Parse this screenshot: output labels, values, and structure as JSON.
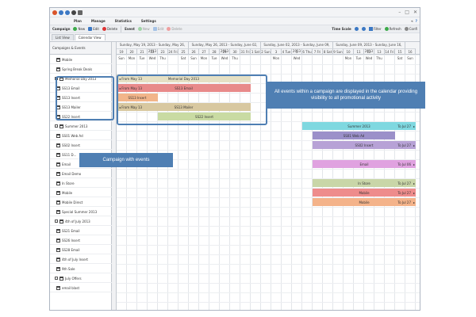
{
  "titlebar": {
    "winbtns": [
      "–",
      "□",
      "✕"
    ]
  },
  "menu": {
    "items": [
      "Plan",
      "Manage",
      "Statistics",
      "Settings"
    ],
    "right": [
      "«",
      "?"
    ]
  },
  "toolbar": {
    "campaign": "Campaign",
    "new": "New",
    "edit": "Edit",
    "delete": "Delete",
    "event": "Event",
    "new2": "New",
    "edit2": "Edit",
    "delete2": "Delete",
    "timescale": "Time Scale",
    "filter": "Filter",
    "refresh": "Refresh",
    "config": "Confi"
  },
  "views": [
    "List View",
    "Calendar View"
  ],
  "left": {
    "header": "Campaigns & Events",
    "rows": [
      {
        "label": "Mobile",
        "group": false
      },
      {
        "label": "Spring Break Deals",
        "group": false
      },
      {
        "label": "Memorial Day 2013",
        "group": true
      },
      {
        "label": "SS13 Email",
        "group": false
      },
      {
        "label": "SS13 Insert",
        "group": false
      },
      {
        "label": "SS13 Mailer",
        "group": false
      },
      {
        "label": "SS22 Insert",
        "group": false
      },
      {
        "label": "Summer 2013",
        "group": true
      },
      {
        "label": "SS01 Web Ad",
        "group": false
      },
      {
        "label": "SS02 Insert",
        "group": false
      },
      {
        "label": "SS11 D...",
        "group": false
      },
      {
        "label": "Email",
        "group": false
      },
      {
        "label": "Email Demo",
        "group": false
      },
      {
        "label": "In Store",
        "group": false
      },
      {
        "label": "Mobile",
        "group": false
      },
      {
        "label": "Mobile Direct",
        "group": false
      },
      {
        "label": "Special Summer 2013",
        "group": false
      },
      {
        "label": "4th of July 2013",
        "group": true
      },
      {
        "label": "SS21 Email",
        "group": false
      },
      {
        "label": "SS26 Insert",
        "group": false
      },
      {
        "label": "SS28 Email",
        "group": false
      },
      {
        "label": "4th of July Insert",
        "group": false
      },
      {
        "label": "9th Sale",
        "group": false
      },
      {
        "label": "July Offers",
        "group": true
      },
      {
        "label": "email blast",
        "group": false
      }
    ]
  },
  "weeks": [
    "Sunday, May 19, 2013 - Sunday, May 26, 2013",
    "Sunday, May 26, 2013 - Sunday, June 02, 2013",
    "Sunday, June 02, 2013 - Sunday, June 09, 2013",
    "Sunday, June 09, 2013 - Sunday, June 16, 2013"
  ],
  "days": [
    "19 Sun",
    "20 Mon",
    "21 Tue",
    "22 Wed",
    "23 Thu",
    "24 Fri",
    "25 Sat",
    "26 Sun",
    "27 Mon",
    "28 Tue",
    "29 Wed",
    "30 Thu",
    "31 Fri",
    "1 Sat",
    "2 Sun",
    "3 Mon",
    "4 Tue",
    "5 Wed",
    "6 Thu",
    "7 Fri",
    "8 Sat",
    "9 Sun",
    "10 Mon",
    "11 Tue",
    "12 Wed",
    "13 Thu",
    "14 Fri",
    "15 Sat",
    "16 Sun"
  ],
  "bars": [
    {
      "row": 2,
      "start": "From May 13",
      "label": "Memorial Day 2013",
      "color": "#e5e0c4"
    },
    {
      "row": 3,
      "start": "From May 13",
      "label": "SS13 Email",
      "color": "#e88a8a"
    },
    {
      "row": 4,
      "start": "",
      "label": "SS13 Insert",
      "color": "#f2b58a"
    },
    {
      "row": 5,
      "start": "From May 13",
      "label": "SS13 Mailer",
      "color": "#d8c8a0"
    },
    {
      "row": 6,
      "start": "",
      "label": "SS22 Insert",
      "color": "#c9dba3"
    },
    {
      "row": 7,
      "start": "",
      "label": "Summer 2013",
      "color": "#7fd8e0",
      "end": "To Jul 27"
    },
    {
      "row": 8,
      "start": "",
      "label": "SS01 Web Ad",
      "color": "#9b90c9"
    },
    {
      "row": 9,
      "start": "",
      "label": "SS02 Insert",
      "color": "#b7a2d6",
      "end": "To Jul 27"
    },
    {
      "row": 11,
      "start": "",
      "label": "Email",
      "color": "#e0a2e0",
      "end": "To Jul 06"
    },
    {
      "row": 13,
      "start": "",
      "label": "In Store",
      "color": "#c9d6a8",
      "end": "To Jul 27"
    },
    {
      "row": 14,
      "start": "",
      "label": "Mobile",
      "color": "#ee8c8c",
      "end": "To Jul 27"
    },
    {
      "row": 15,
      "start": "",
      "label": "Mobile",
      "color": "#f4b38a",
      "end": "To Jul 27"
    }
  ],
  "callouts": {
    "left": "Campaign with events",
    "right": "All events within a campaign are displayed in the calendar providing visibility to all promotional activity"
  }
}
